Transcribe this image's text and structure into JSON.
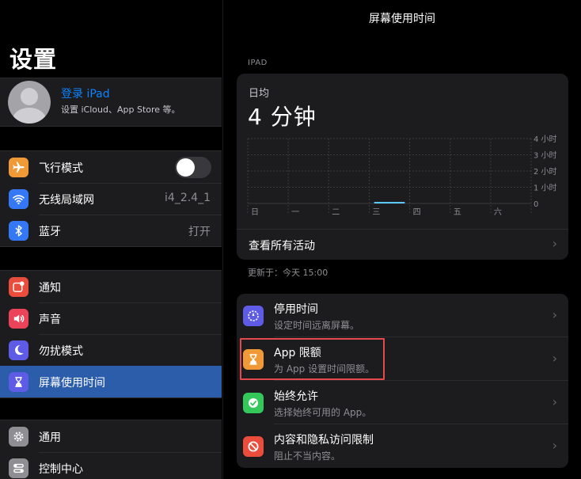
{
  "sidebar": {
    "title": "设置",
    "profile": {
      "name": "登录 iPad",
      "subtitle": "设置 iCloud、App Store 等。"
    },
    "groups": [
      [
        {
          "label": "飞行模式",
          "icon": "airplane-icon",
          "color": "#f09a37",
          "toggle": false
        },
        {
          "label": "无线局域网",
          "icon": "wifi-icon",
          "color": "#3478f6",
          "value": "i4_2.4_1"
        },
        {
          "label": "蓝牙",
          "icon": "bluetooth-icon",
          "color": "#3478f6",
          "value": "打开"
        }
      ],
      [
        {
          "label": "通知",
          "icon": "notification-icon",
          "color": "#eb4d3d"
        },
        {
          "label": "声音",
          "icon": "speaker-icon",
          "color": "#eb445a"
        },
        {
          "label": "勿扰模式",
          "icon": "moon-icon",
          "color": "#5e5ce6"
        },
        {
          "label": "屏幕使用时间",
          "icon": "hourglass-icon",
          "color": "#5e5ce6",
          "selected": true
        }
      ],
      [
        {
          "label": "通用",
          "icon": "gear-icon",
          "color": "#8e8e93"
        },
        {
          "label": "控制中心",
          "icon": "control-center-icon",
          "color": "#8e8e93"
        }
      ]
    ]
  },
  "main": {
    "nav_title": "屏幕使用时间",
    "section_label": "IPAD",
    "daily_average_label": "日均",
    "daily_average_value": "4 分钟",
    "see_all_label": "查看所有活动",
    "updated_text": "更新于：今天 15:00",
    "menu": [
      {
        "title": "停用时间",
        "subtitle": "设定时间远离屏幕。",
        "icon": "downtime-icon",
        "color": "#5e5ce6"
      },
      {
        "title": "App 限额",
        "subtitle": "为 App 设置时间限额。",
        "icon": "hourglass-icon",
        "color": "#f09a37",
        "highlighted": true
      },
      {
        "title": "始终允许",
        "subtitle": "选择始终可用的 App。",
        "icon": "checkmark-badge-icon",
        "color": "#34c759"
      },
      {
        "title": "内容和隐私访问限制",
        "subtitle": "阻止不当内容。",
        "icon": "restriction-icon",
        "color": "#eb4d3d"
      }
    ]
  },
  "chart_data": {
    "type": "bar",
    "categories": [
      "日",
      "一",
      "二",
      "三",
      "四",
      "五",
      "六"
    ],
    "values": [
      0,
      0,
      0,
      4,
      0,
      0,
      0
    ],
    "y_ticks": [
      "4 小时",
      "3 小时",
      "2 小时",
      "1 小时",
      "0"
    ],
    "y_tick_values": [
      240,
      180,
      120,
      60,
      0
    ],
    "ylim": [
      0,
      240
    ],
    "grid": true,
    "bar_color": "#5ac8fa"
  }
}
